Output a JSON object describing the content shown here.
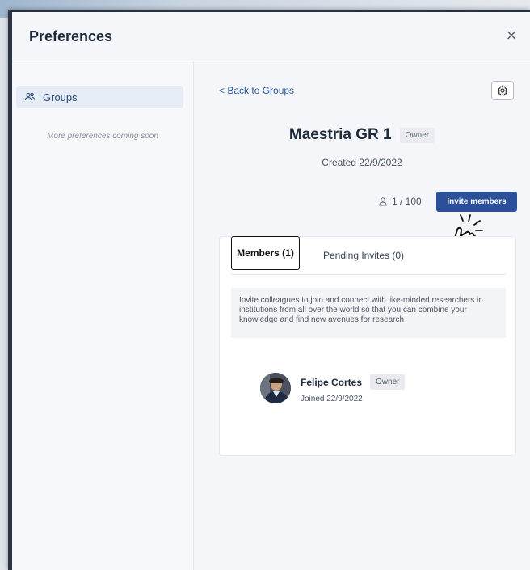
{
  "modal": {
    "title": "Preferences",
    "close_symbol": "×"
  },
  "sidebar": {
    "items": [
      {
        "label": "Groups",
        "icon": "groups-icon"
      }
    ],
    "note": "More preferences coming soon"
  },
  "group": {
    "back_label": "< Back to Groups",
    "name": "Maestria GR 1",
    "role_badge": "Owner",
    "created": "Created 22/9/2022",
    "member_count": "1 / 100",
    "invite_label": "Invite members"
  },
  "tabs": [
    {
      "label": "Members (1)",
      "active": true
    },
    {
      "label": "Pending Invites (0)",
      "active": false
    }
  ],
  "info_text": "Invite colleagues to join and connect with like-minded researchers in institutions from all over the world so that you can combine your knowledge and find new avenues for research",
  "members": [
    {
      "name": "Felipe Cortes",
      "role": "Owner",
      "joined": "Joined 22/9/2022"
    }
  ],
  "colors": {
    "accent": "#2b4f9a",
    "link": "#2c5aa0",
    "sidebar_active_bg": "#e6ecf5"
  }
}
